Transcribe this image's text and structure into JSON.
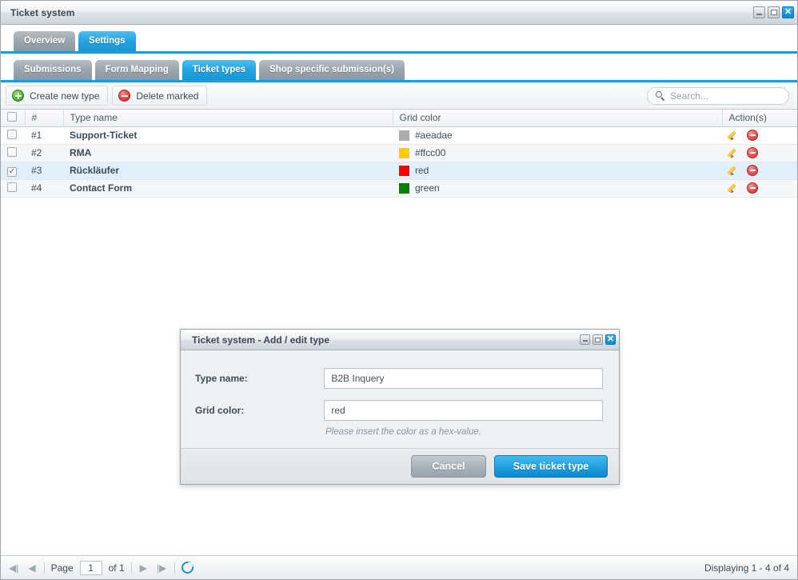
{
  "window": {
    "title": "Ticket system",
    "controls": {
      "minimize": "–",
      "maximize": "□",
      "close": "✕"
    }
  },
  "outer_tabs": [
    {
      "label": "Overview",
      "active": false
    },
    {
      "label": "Settings",
      "active": true
    }
  ],
  "inner_tabs": [
    {
      "label": "Submissions",
      "active": false
    },
    {
      "label": "Form Mapping",
      "active": false
    },
    {
      "label": "Ticket types",
      "active": true
    },
    {
      "label": "Shop specific submission(s)",
      "active": false
    }
  ],
  "toolbar": {
    "create_label": "Create new type",
    "delete_label": "Delete marked",
    "search_placeholder": "Search..."
  },
  "grid": {
    "columns": [
      "",
      "#",
      "Type name",
      "Grid color",
      "Action(s)"
    ],
    "rows": [
      {
        "num": "#1",
        "name": "Support-Ticket",
        "color_label": "#aeadae",
        "color_hex": "#aeadae",
        "checked": false,
        "selected": false
      },
      {
        "num": "#2",
        "name": "RMA",
        "color_label": "#ffcc00",
        "color_hex": "#ffcc00",
        "checked": false,
        "selected": false
      },
      {
        "num": "#3",
        "name": "Rückläufer",
        "color_label": "red",
        "color_hex": "#ff0000",
        "checked": true,
        "selected": true
      },
      {
        "num": "#4",
        "name": "Contact Form",
        "color_label": "green",
        "color_hex": "#008000",
        "checked": false,
        "selected": false
      }
    ]
  },
  "pager": {
    "first": "◀|",
    "prev": "◀",
    "page_label": "Page",
    "page_value": "1",
    "of_label": "of 1",
    "next": "▶",
    "last": "|▶",
    "status": "Displaying 1 - 4 of 4"
  },
  "modal": {
    "title": "Ticket system - Add / edit type",
    "type_name_label": "Type name:",
    "type_name_value": "B2B Inquery",
    "grid_color_label": "Grid color:",
    "grid_color_value": "red",
    "hint": "Please insert the color as a hex-value.",
    "cancel_label": "Cancel",
    "save_label": "Save ticket type"
  },
  "theme": {
    "accent": "#1e9cd7",
    "selected_row": "#e3eff8"
  }
}
